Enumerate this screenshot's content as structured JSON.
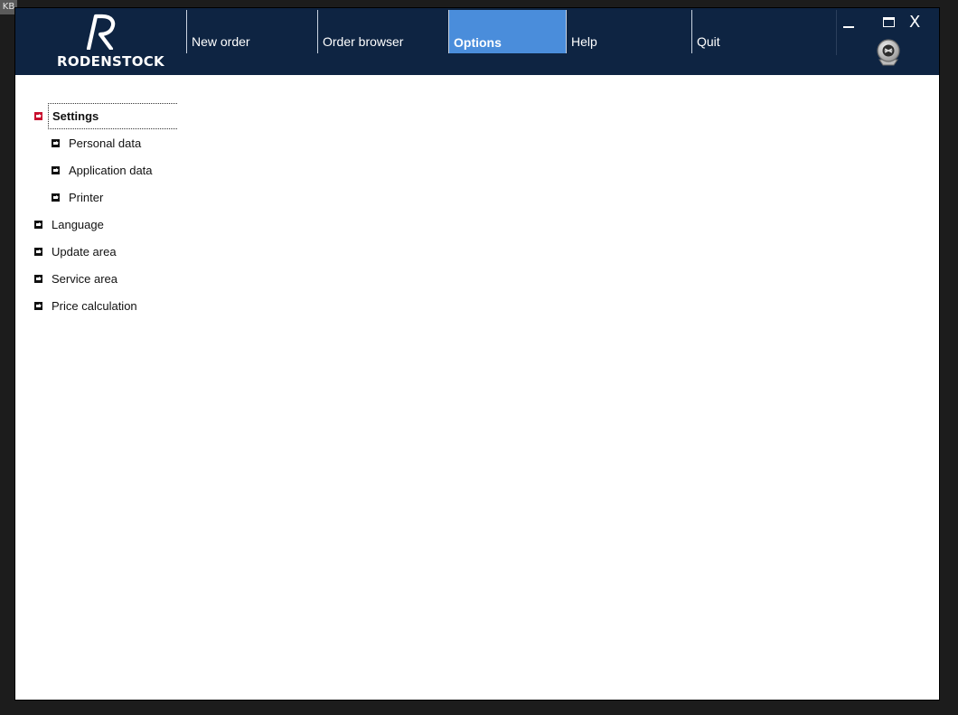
{
  "overlay": {
    "tag": "KB"
  },
  "app": {
    "brand": "RODENSTOCK"
  },
  "nav": {
    "items": [
      {
        "label": "New order"
      },
      {
        "label": "Order browser"
      },
      {
        "label": "Options"
      },
      {
        "label": "Help"
      },
      {
        "label": "Quit"
      }
    ],
    "active": "Options"
  },
  "window_controls": {
    "close_label": "X"
  },
  "tree": {
    "settings": {
      "label": "Settings",
      "children": [
        {
          "label": "Personal data"
        },
        {
          "label": "Application data"
        },
        {
          "label": "Printer"
        }
      ]
    },
    "items": [
      {
        "label": "Language"
      },
      {
        "label": "Update area"
      },
      {
        "label": "Service area"
      },
      {
        "label": "Price calculation"
      }
    ]
  },
  "colors": {
    "header_bg": "#0e2442",
    "active_tab": "#4a8ddb",
    "selected_bullet": "#c8102e"
  }
}
